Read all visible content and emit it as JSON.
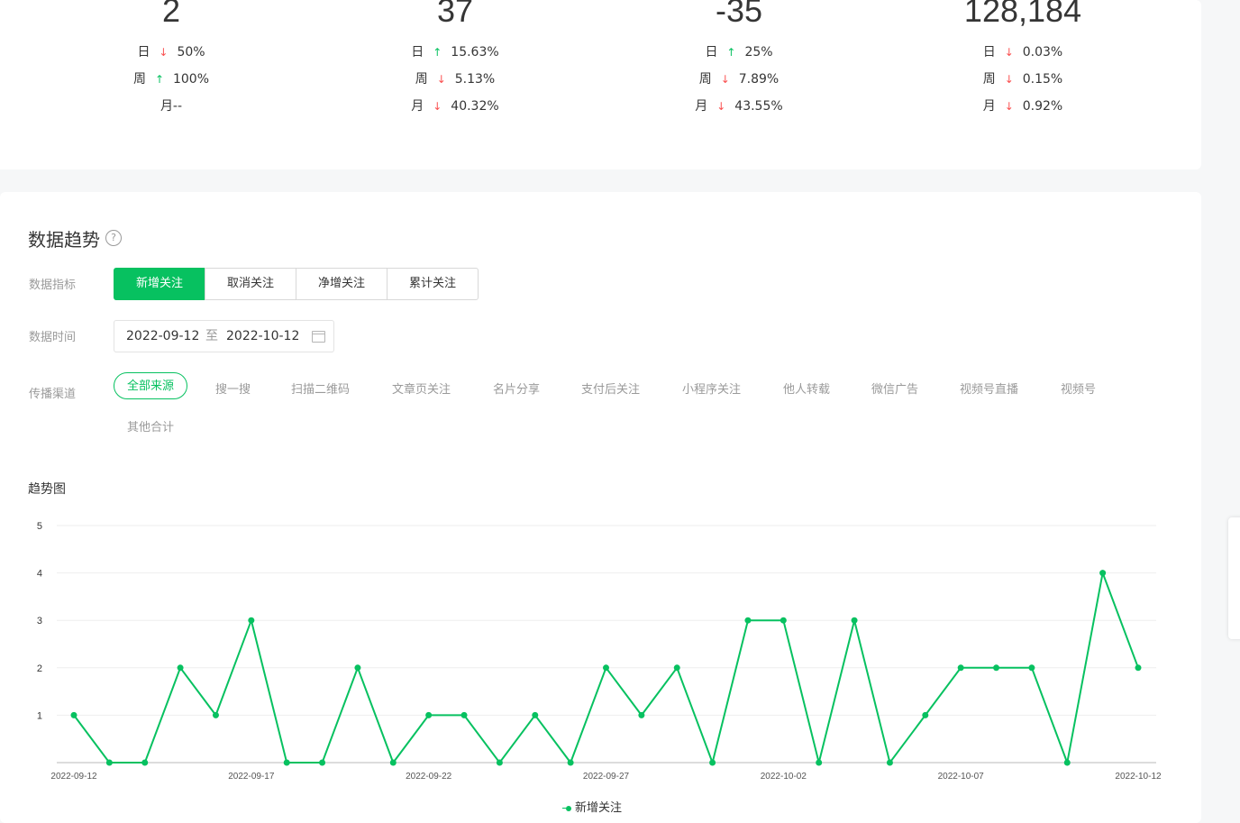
{
  "stats": [
    {
      "value": "2",
      "rows": [
        {
          "label": "日",
          "dir": "down",
          "pct": "50%"
        },
        {
          "label": "周",
          "dir": "up",
          "pct": "100%"
        },
        {
          "label": "月--",
          "dir": "none",
          "pct": ""
        }
      ]
    },
    {
      "value": "37",
      "rows": [
        {
          "label": "日",
          "dir": "up",
          "pct": "15.63%"
        },
        {
          "label": "周",
          "dir": "down",
          "pct": "5.13%"
        },
        {
          "label": "月",
          "dir": "down",
          "pct": "40.32%"
        }
      ]
    },
    {
      "value": "-35",
      "rows": [
        {
          "label": "日",
          "dir": "up",
          "pct": "25%"
        },
        {
          "label": "周",
          "dir": "down",
          "pct": "7.89%"
        },
        {
          "label": "月",
          "dir": "down",
          "pct": "43.55%"
        }
      ]
    },
    {
      "value": "128,184",
      "rows": [
        {
          "label": "日",
          "dir": "down",
          "pct": "0.03%"
        },
        {
          "label": "周",
          "dir": "down",
          "pct": "0.15%"
        },
        {
          "label": "月",
          "dir": "down",
          "pct": "0.92%"
        }
      ]
    }
  ],
  "trend": {
    "title": "数据趋势",
    "help_glyph": "?",
    "metric_label": "数据指标",
    "metrics": [
      "新增关注",
      "取消关注",
      "净增关注",
      "累计关注"
    ],
    "active_metric": 0,
    "time_label": "数据时间",
    "date_start": "2022-09-12",
    "date_sep": "至",
    "date_end": "2022-10-12",
    "channel_label": "传播渠道",
    "channels": [
      "全部来源",
      "搜一搜",
      "扫描二维码",
      "文章页关注",
      "名片分享",
      "支付后关注",
      "小程序关注",
      "他人转载",
      "微信广告",
      "视频号直播",
      "视频号",
      "其他合计"
    ],
    "active_channel": 0,
    "chart_title": "趋势图",
    "legend": "新增关注"
  },
  "colors": {
    "accent": "#07c160",
    "down": "#fa5151",
    "up": "#07c160"
  },
  "chart_data": {
    "type": "line",
    "x": [
      "2022-09-12",
      "2022-09-13",
      "2022-09-14",
      "2022-09-15",
      "2022-09-16",
      "2022-09-17",
      "2022-09-18",
      "2022-09-19",
      "2022-09-20",
      "2022-09-21",
      "2022-09-22",
      "2022-09-23",
      "2022-09-24",
      "2022-09-25",
      "2022-09-26",
      "2022-09-27",
      "2022-09-28",
      "2022-09-29",
      "2022-09-30",
      "2022-10-01",
      "2022-10-02",
      "2022-10-03",
      "2022-10-04",
      "2022-10-05",
      "2022-10-06",
      "2022-10-07",
      "2022-10-08",
      "2022-10-09",
      "2022-10-10",
      "2022-10-11",
      "2022-10-12"
    ],
    "x_ticks": [
      "2022-09-12",
      "2022-09-17",
      "2022-09-22",
      "2022-09-27",
      "2022-10-02",
      "2022-10-07",
      "2022-10-12"
    ],
    "y_ticks": [
      1,
      2,
      3,
      4,
      5
    ],
    "ylim": [
      0,
      5
    ],
    "series": [
      {
        "name": "新增关注",
        "values": [
          1,
          0,
          0,
          2,
          1,
          3,
          0,
          0,
          2,
          0,
          1,
          1,
          0,
          1,
          0,
          2,
          1,
          2,
          0,
          3,
          3,
          0,
          3,
          0,
          1,
          2,
          2,
          2,
          0,
          4,
          2
        ]
      }
    ],
    "grid": true,
    "legend_position": "bottom"
  }
}
